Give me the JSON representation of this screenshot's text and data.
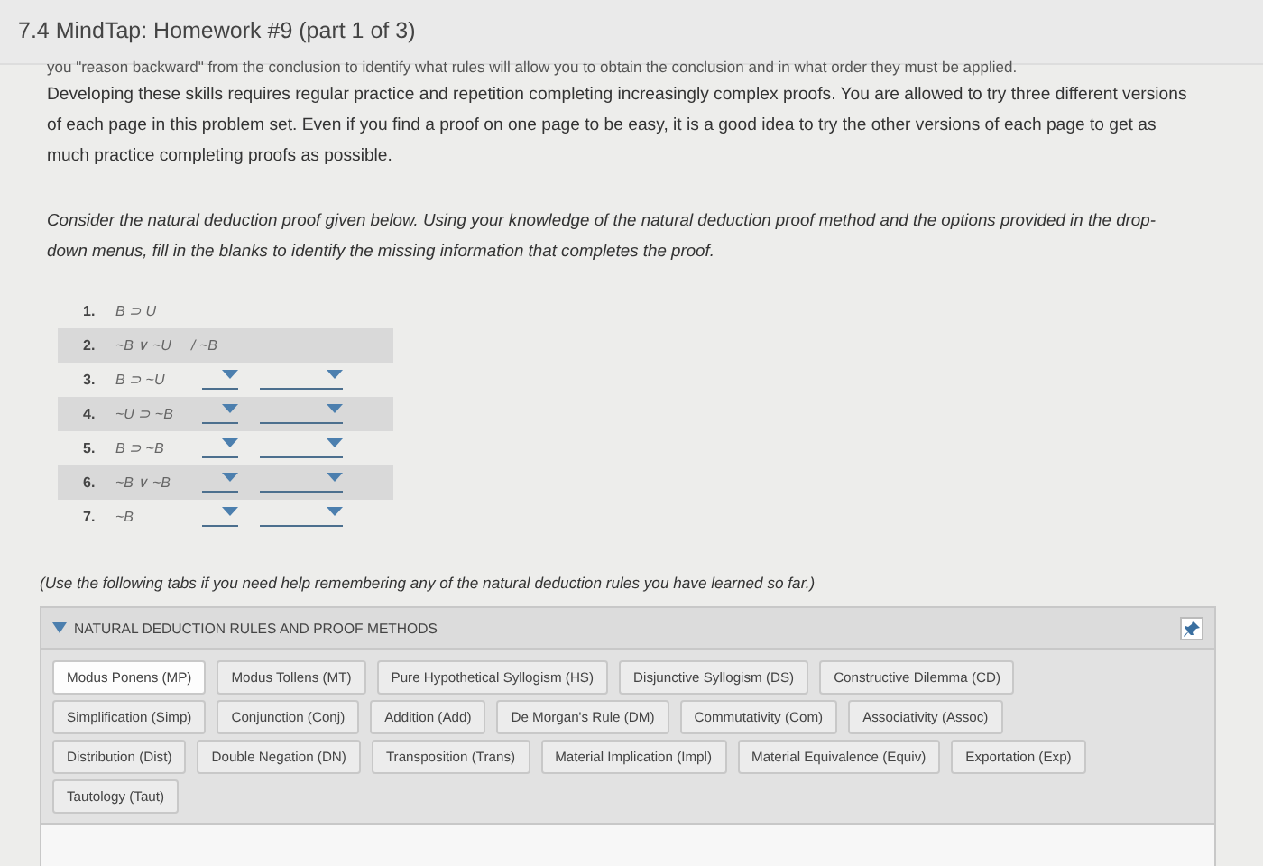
{
  "window": {
    "title": "7.4 MindTap: Homework #9 (part 1 of 3)"
  },
  "intro": {
    "cut_line": "you \"reason backward\" from the conclusion to identify what rules will allow you to obtain the conclusion and in what order they must be applied.",
    "paragraph": "Developing these skills requires regular practice and repetition completing increasingly complex proofs. You are allowed to try three different versions of each page in this problem set. Even if you find a proof on one page to be easy, it is a good idea to try the other versions of each page to get as much practice completing proofs as possible."
  },
  "instructions": "Consider the natural deduction proof given below. Using your knowledge of the natural deduction proof method and the options provided in the drop-down menus, fill in the blanks to identify the missing information that completes the proof.",
  "proof": {
    "lines": [
      {
        "number": "1.",
        "formula": "B ⊃ U",
        "kind": "premise"
      },
      {
        "number": "2.",
        "formula": "~B ∨ ~U",
        "kind": "premise",
        "conclusion": "/ ~B"
      },
      {
        "number": "3.",
        "formula": "B ⊃ ~U",
        "kind": "step"
      },
      {
        "number": "4.",
        "formula": "~U ⊃ ~B",
        "kind": "step"
      },
      {
        "number": "5.",
        "formula": "B ⊃ ~B",
        "kind": "step"
      },
      {
        "number": "6.",
        "formula": "~B ∨ ~B",
        "kind": "step"
      },
      {
        "number": "7.",
        "formula": "~B",
        "kind": "step"
      }
    ]
  },
  "help_note": "(Use the following tabs if you need help remembering any of the natural deduction rules you have learned so far.)",
  "rules_panel": {
    "title": "NATURAL DEDUCTION RULES AND PROOF METHODS",
    "expanded": true,
    "tab_rows": [
      [
        {
          "label": "Modus Ponens (MP)",
          "selected": true
        },
        {
          "label": "Modus Tollens (MT)",
          "selected": false
        },
        {
          "label": "Pure Hypothetical Syllogism (HS)",
          "selected": false
        },
        {
          "label": "Disjunctive Syllogism (DS)",
          "selected": false
        },
        {
          "label": "Constructive Dilemma (CD)",
          "selected": false
        }
      ],
      [
        {
          "label": "Simplification (Simp)",
          "selected": false
        },
        {
          "label": "Conjunction (Conj)",
          "selected": false
        },
        {
          "label": "Addition (Add)",
          "selected": false
        },
        {
          "label": "De Morgan's Rule (DM)",
          "selected": false
        },
        {
          "label": "Commutativity (Com)",
          "selected": false
        },
        {
          "label": "Associativity (Assoc)",
          "selected": false
        }
      ],
      [
        {
          "label": "Distribution (Dist)",
          "selected": false
        },
        {
          "label": "Double Negation (DN)",
          "selected": false
        },
        {
          "label": "Transposition (Trans)",
          "selected": false
        },
        {
          "label": "Material Implication (Impl)",
          "selected": false
        },
        {
          "label": "Material Equivalence (Equiv)",
          "selected": false
        },
        {
          "label": "Exportation (Exp)",
          "selected": false
        }
      ],
      [
        {
          "label": "Tautology (Taut)",
          "selected": false
        }
      ]
    ]
  }
}
